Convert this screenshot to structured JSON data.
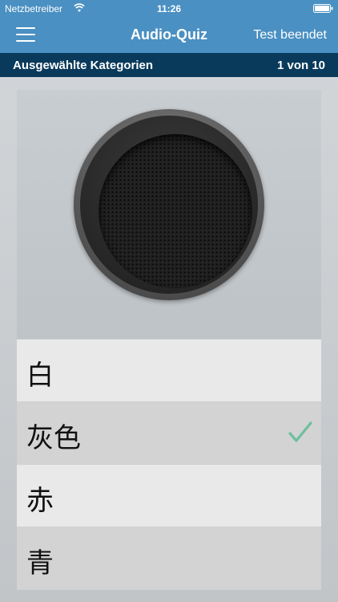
{
  "status_bar": {
    "carrier": "Netzbetreiber",
    "time": "11:26",
    "wifi_icon": "wifi-icon",
    "battery_icon": "battery-icon"
  },
  "nav": {
    "menu_icon": "hamburger-menu-icon",
    "title": "Audio-Quiz",
    "action": "Test beendet"
  },
  "sub_header": {
    "label": "Ausgewählte Kategorien",
    "progress": "1 von 10"
  },
  "speaker": {
    "icon": "speaker-icon"
  },
  "answers": [
    {
      "label": "白",
      "selected": false
    },
    {
      "label": "灰色",
      "selected": true
    },
    {
      "label": "赤",
      "selected": false
    },
    {
      "label": "青",
      "selected": false
    }
  ],
  "colors": {
    "nav_blue": "#4a90c2",
    "sub_header_navy": "#0a3a5b",
    "check_green": "#6fbf9f",
    "answer_light": "#e9e9e9",
    "answer_dark": "#d3d3d3"
  }
}
